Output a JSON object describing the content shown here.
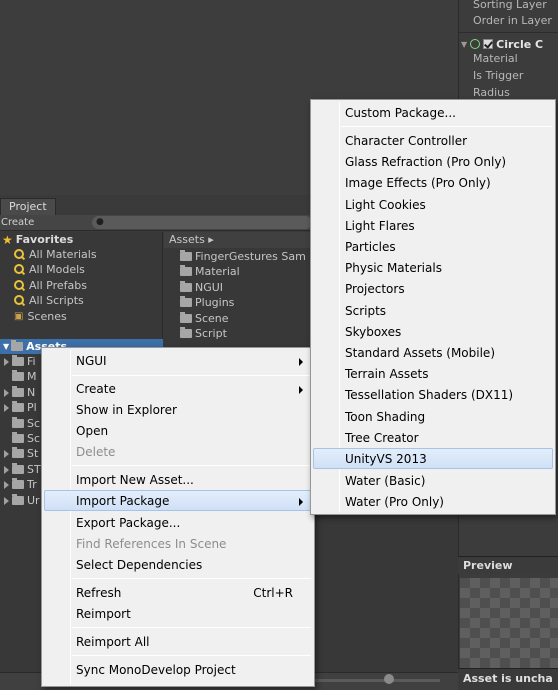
{
  "inspector": {
    "rows": [
      "Sorting Layer",
      "Order in Layer"
    ],
    "component_title": "Circle C",
    "component_rows": [
      "Material",
      "Is Trigger",
      "Radius"
    ]
  },
  "project": {
    "tab": "Project",
    "create_label": "Create ▾",
    "favorites": {
      "title": "Favorites",
      "items": [
        "All Materials",
        "All Models",
        "All Prefabs",
        "All Scripts",
        "Scenes"
      ]
    },
    "tree_root": "Assets",
    "tree_items": [
      "Fi",
      "M",
      "N",
      "Pl",
      "Sc",
      "Sc",
      "St",
      "ST",
      "Tr",
      "Ur"
    ],
    "assets_header": "Assets ▸",
    "asset_folders": [
      "FingerGestures Sam",
      "Material",
      "NGUI",
      "Plugins",
      "Scene",
      "Script"
    ]
  },
  "preview": {
    "title": "Preview"
  },
  "status": {
    "text": "Asset is uncha"
  },
  "context_menu": {
    "items": [
      {
        "label": "NGUI",
        "submenu": true
      },
      {
        "label": "Create",
        "submenu": true
      },
      {
        "label": "Show in Explorer"
      },
      {
        "label": "Open"
      },
      {
        "label": "Delete",
        "disabled": true
      },
      {
        "label": "Import New Asset..."
      },
      {
        "label": "Import Package",
        "submenu": true,
        "highlighted": true
      },
      {
        "label": "Export Package..."
      },
      {
        "label": "Find References In Scene",
        "disabled": true
      },
      {
        "label": "Select Dependencies"
      },
      {
        "label": "Refresh",
        "shortcut": "Ctrl+R"
      },
      {
        "label": "Reimport"
      },
      {
        "label": "Reimport All"
      },
      {
        "label": "Sync MonoDevelop Project"
      }
    ]
  },
  "import_submenu": {
    "items": [
      {
        "label": "Custom Package..."
      },
      {
        "label": "Character Controller"
      },
      {
        "label": "Glass Refraction (Pro Only)"
      },
      {
        "label": "Image Effects (Pro Only)"
      },
      {
        "label": "Light Cookies"
      },
      {
        "label": "Light Flares"
      },
      {
        "label": "Particles"
      },
      {
        "label": "Physic Materials"
      },
      {
        "label": "Projectors"
      },
      {
        "label": "Scripts"
      },
      {
        "label": "Skyboxes"
      },
      {
        "label": "Standard Assets (Mobile)"
      },
      {
        "label": "Terrain Assets"
      },
      {
        "label": "Tessellation Shaders (DX11)"
      },
      {
        "label": "Toon Shading"
      },
      {
        "label": "Tree Creator"
      },
      {
        "label": "UnityVS 2013",
        "highlighted": true
      },
      {
        "label": "Water (Basic)"
      },
      {
        "label": "Water (Pro Only)"
      }
    ]
  }
}
